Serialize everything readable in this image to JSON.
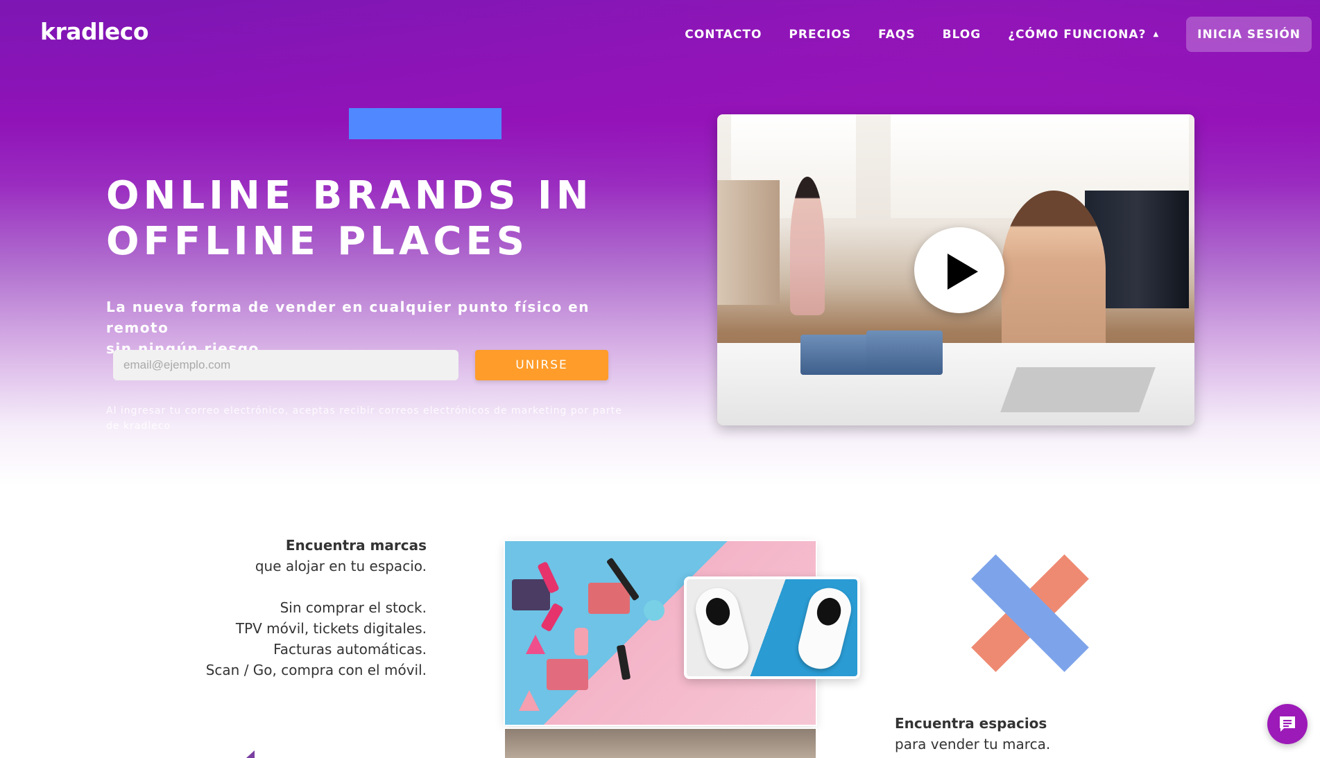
{
  "brand": {
    "logo_text": "kradleco"
  },
  "nav": {
    "items": [
      {
        "label": "CONTACTO"
      },
      {
        "label": "PRECIOS"
      },
      {
        "label": "FAQS"
      },
      {
        "label": "BLOG"
      },
      {
        "label": "¿CÓMO FUNCIONA?",
        "icon": "caret-up-icon"
      }
    ],
    "login_label": "INICIA SESIÓN"
  },
  "hero": {
    "title_line1": "ONLINE BRANDS IN",
    "title_line2": "OFFLINE PLACES",
    "subtitle_line1": "La nueva forma de vender en cualquier punto físico en remoto",
    "subtitle_line2": "sin ningún riesgo.",
    "email_placeholder": "email@ejemplo.com",
    "email_value": "",
    "join_label": "UNIRSE",
    "disclaimer_line1": "Al ingresar tu correo electrónico, aceptas recibir correos electrónicos de marketing por parte",
    "disclaimer_line2": "de kradleco",
    "video_icon": "play-icon"
  },
  "features_left": {
    "heading": "Encuentra marcas",
    "heading_sub": "que alojar en tu espacio.",
    "items": [
      "Sin comprar el stock.",
      "TPV móvil, tickets digitales.",
      "Facturas automáticas.",
      "Scan / Go, compra con el móvil."
    ]
  },
  "features_right": {
    "heading": "Encuentra espacios",
    "heading_sub": "para vender tu marca."
  },
  "colors": {
    "purple": "#8e14b8",
    "accent_blue": "#4f88ff",
    "orange": "#ff9c2a",
    "x_blue": "#7da4ea",
    "x_coral": "#ee8a72",
    "chat": "#9c1ab8"
  },
  "chat": {
    "icon": "chat-icon"
  }
}
